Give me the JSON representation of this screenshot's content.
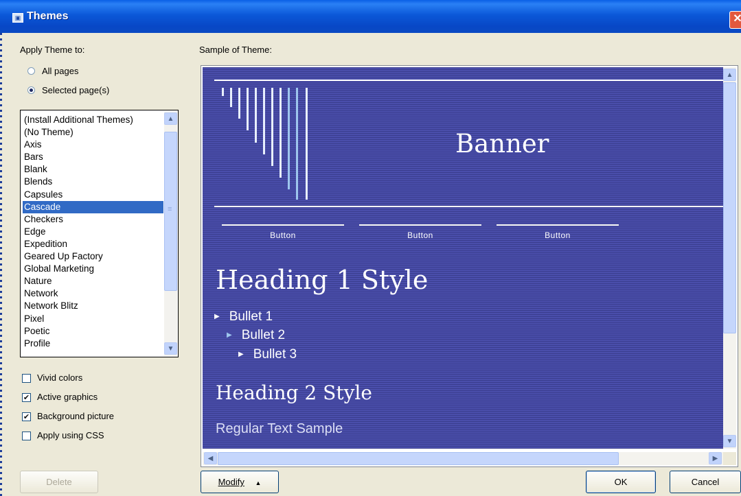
{
  "window": {
    "title": "Themes",
    "close_glyph": "✕"
  },
  "apply": {
    "label": "Apply Theme to:",
    "options": [
      {
        "label": "All pages",
        "selected": false
      },
      {
        "label": "Selected page(s)",
        "selected": true
      }
    ]
  },
  "themes": {
    "items": [
      "(Install Additional Themes)",
      "(No Theme)",
      "Axis",
      "Bars",
      "Blank",
      "Blends",
      "Capsules",
      "Cascade",
      "Checkers",
      "Edge",
      "Expedition",
      "Geared Up Factory",
      "Global Marketing",
      "Nature",
      "Network",
      "Network Blitz",
      "Pixel",
      "Poetic",
      "Profile"
    ],
    "selected": "Cascade"
  },
  "options": {
    "vivid_colors": {
      "label": "Vivid colors",
      "checked": false
    },
    "active_graphics": {
      "label": "Active graphics",
      "checked": true
    },
    "background_picture": {
      "label": "Background picture",
      "checked": true
    },
    "apply_css": {
      "label": "Apply using CSS",
      "checked": false
    }
  },
  "sample": {
    "label": "Sample of Theme:",
    "banner": "Banner",
    "nav_buttons": [
      "Button",
      "Button",
      "Button"
    ],
    "heading1": "Heading 1 Style",
    "bullets": [
      "Bullet 1",
      "Bullet 2",
      "Bullet 3"
    ],
    "heading2": "Heading 2 Style",
    "regular_text": "Regular Text Sample",
    "colors": {
      "background": "#4a4eab",
      "accent": "#9ec6ee"
    }
  },
  "buttons": {
    "delete": "Delete",
    "modify": "Modify",
    "modify_arrow": "▲",
    "ok": "OK",
    "cancel": "Cancel"
  },
  "icons": {
    "scroll_up": "▲",
    "scroll_down": "▼",
    "scroll_left": "◀",
    "scroll_right": "▶"
  }
}
